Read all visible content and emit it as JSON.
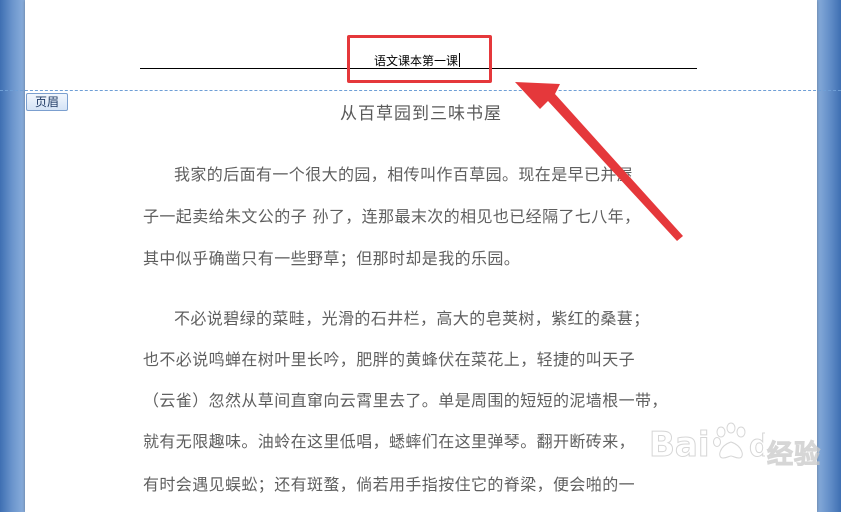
{
  "header": {
    "text": "语文课本第一课",
    "tab_label": "页眉"
  },
  "document": {
    "title": "从百草园到三味书屋",
    "lines": [
      "我家的后面有一个很大的园，相传叫作百草园。现在是早已并屋",
      "子一起卖给朱文公的子 孙了，连那最末次的相见也已经隔了七八年，",
      "其中似乎确凿只有一些野草；但那时却是我的乐园。",
      "不必说碧绿的菜畦，光滑的石井栏，高大的皂荚树，紫红的桑葚；",
      "也不必说鸣蝉在树叶里长吟，肥胖的黄蜂伏在菜花上，轻捷的叫天子",
      "（云雀）忽然从草间直窜向云霄里去了。单是周围的短短的泥墙根一带，",
      "就有无限趣味。油蛉在这里低唱，蟋蟀们在这里弹琴。翻开断砖来，",
      "有时会遇见蜈蚣；还有斑蝥，倘若用手指按住它的脊梁，便会啪的一"
    ]
  },
  "watermark": {
    "text": "经验",
    "logo": "Baidu"
  },
  "colors": {
    "annotation": "#e5383b",
    "workspace": "#a9c4e8",
    "boundary": "#6f9fd6"
  }
}
